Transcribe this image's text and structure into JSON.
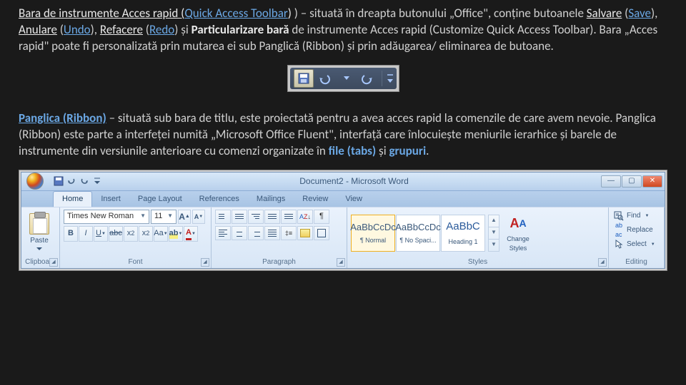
{
  "para1": {
    "t1": "Bara de instrumente Acces rapid (",
    "qat": "Quick Access Toolbar",
    "t2": ") – situată în dreapta butonului „Office\", conține butoanele ",
    "save_ro": "Salvare",
    "save_en": "Save",
    "undo_ro": "Anulare",
    "undo_en": "Undo",
    "redo_ro": "Refacere",
    "redo_en": "Redo",
    "t3": " și ",
    "cust": "Particularizare bară",
    "t4": " de instrumente Acces rapid (Customize Quick Access Toolbar). Bara „Acces rapid\" poate fi personalizată prin mutarea ei sub Panglică (Ribbon) și prin adăugarea/ eliminarea de butoane."
  },
  "para2": {
    "ribbon": "Panglica (Ribbon)",
    "t1": " – situată sub bara de titlu, este proiectată pentru a avea acces rapid la comenzile de care avem nevoie. Panglica (Ribbon) este parte a interfeței numită „Microsoft Office Fluent\", interfață care înlocuiește meniurile ierarhice și barele de instrumente din versiunile anterioare cu comenzi organizate în ",
    "file": "file (tabs)",
    "t2": " și ",
    "grp": "grupuri",
    "t3": "."
  },
  "word": {
    "doc_title": "Document2 - Microsoft Word",
    "tabs": [
      "Home",
      "Insert",
      "Page Layout",
      "References",
      "Mailings",
      "Review",
      "View"
    ],
    "paste": "Paste",
    "clipboard": "Clipboard",
    "font_name": "Times New Roman",
    "font_size": "11",
    "font_lbl": "Font",
    "para_lbl": "Paragraph",
    "styles_lbl": "Styles",
    "editing_lbl": "Editing",
    "styles": [
      {
        "prev": "AaBbCcDc",
        "name": "¶ Normal"
      },
      {
        "prev": "AaBbCcDc",
        "name": "¶ No Spaci..."
      },
      {
        "prev": "AaBbC",
        "name": "Heading 1"
      }
    ],
    "change_styles": "Change Styles",
    "find": "Find",
    "replace": "Replace",
    "select": "Select"
  }
}
